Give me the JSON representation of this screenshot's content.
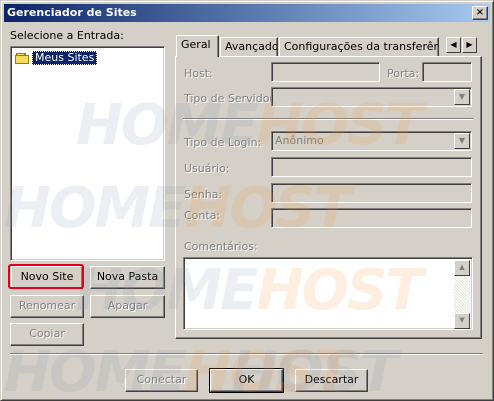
{
  "window": {
    "title": "Gerenciador de Sites",
    "close_glyph": "×"
  },
  "watermark": {
    "part1": "HOME",
    "part2": "HOST"
  },
  "left": {
    "select_label": "Selecione a Entrada:",
    "tree": [
      {
        "label": "Meus Sites",
        "icon": "folder-icon",
        "selected": true
      }
    ],
    "buttons": {
      "new_site": "Novo Site",
      "new_folder": "Nova Pasta",
      "rename": "Renomear",
      "delete": "Apagar",
      "copy": "Copiar"
    },
    "highlight_color": "#e0001b"
  },
  "tabs": [
    "Geral",
    "Avançado",
    "Configurações da transferência"
  ],
  "tab_scroll": {
    "left": "◀",
    "right": "▶"
  },
  "general": {
    "host_label": "Host:",
    "port_label": "Porta:",
    "server_type_label": "Tipo de Servidor:",
    "login_type_label": "Tipo de Login:",
    "login_type_value": "Anônimo",
    "user_label": "Usuário:",
    "password_label": "Senha:",
    "account_label": "Conta:",
    "comments_label": "Comentários:",
    "host_value": "",
    "port_value": "",
    "server_type_value": ""
  },
  "footer": {
    "connect": "Conectar",
    "ok": "OK",
    "cancel": "Descartar"
  }
}
